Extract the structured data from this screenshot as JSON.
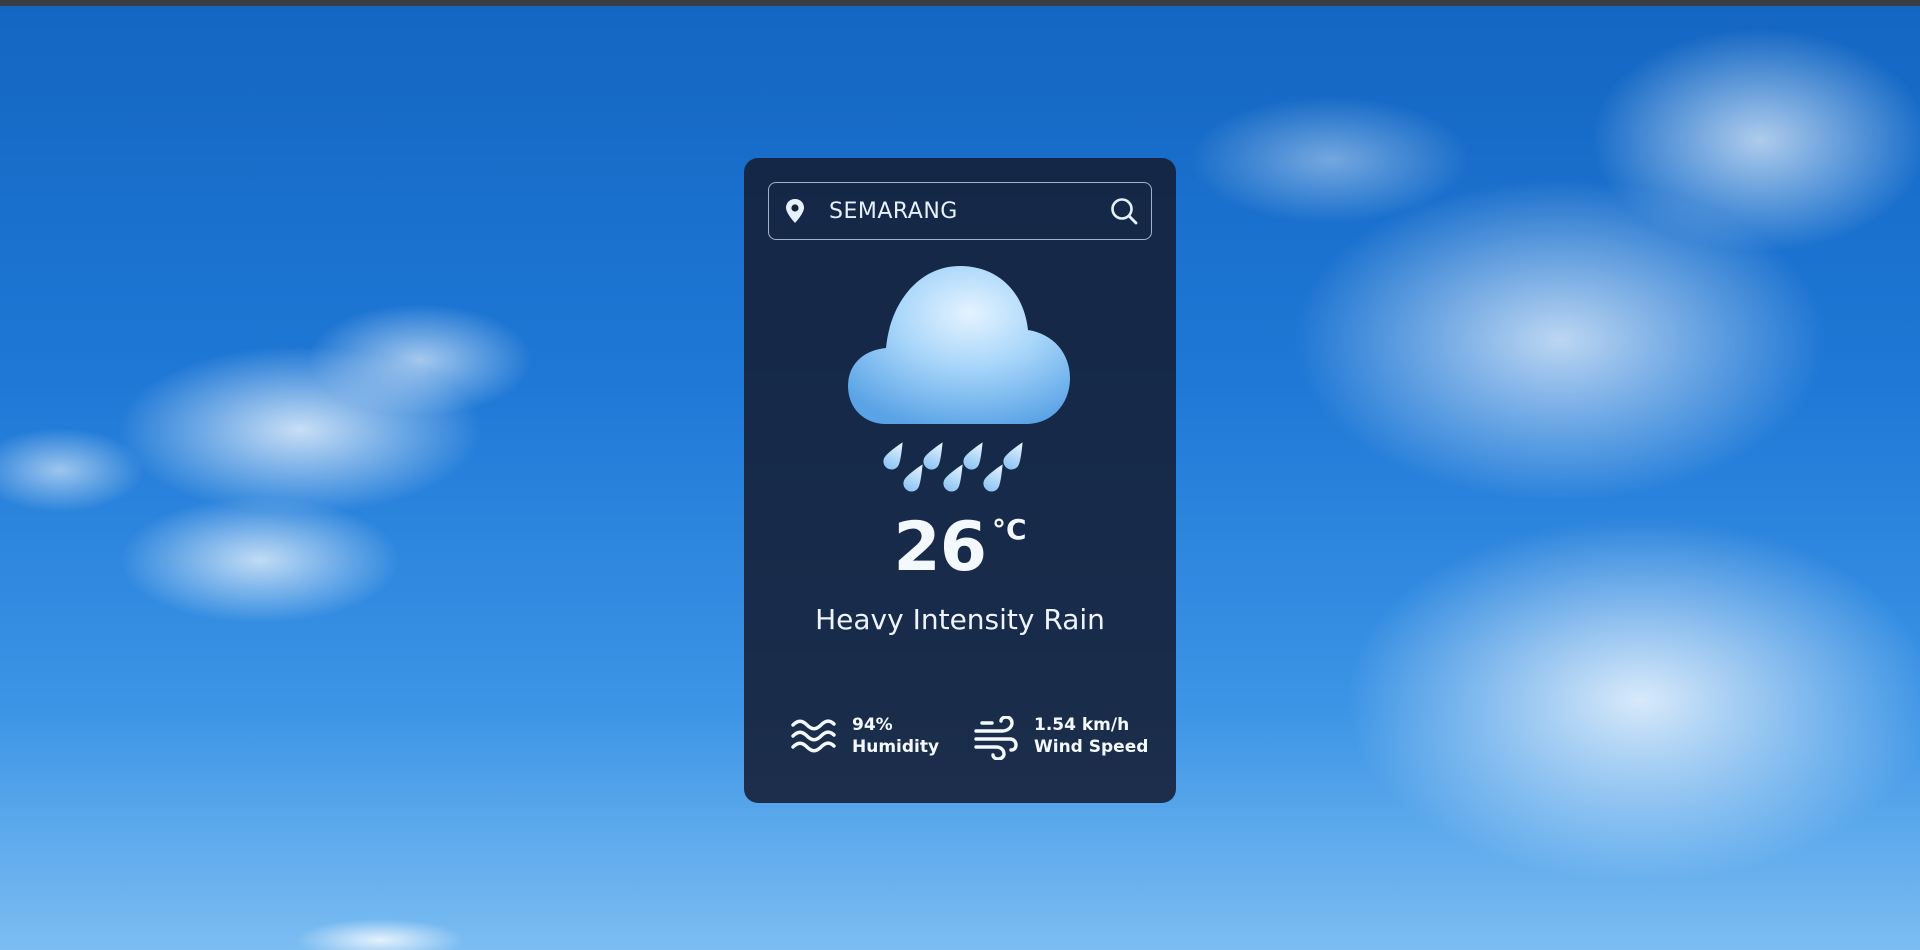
{
  "colors": {
    "card_background": "#141e34",
    "text": "#f4f8ff",
    "cloud": "#9fd0f7",
    "raindrop": "#cde6fb",
    "sky": "#1f78d6"
  },
  "search": {
    "value": "SEMARANG",
    "location_icon": "map-pin-icon",
    "search_icon": "magnifier-icon"
  },
  "weather": {
    "icon": "heavy-rain-cloud-icon",
    "temperature": "26",
    "unit": "°C",
    "description": "Heavy Intensity Rain"
  },
  "details": {
    "humidity": {
      "icon": "waves-icon",
      "value": "94%",
      "label": "Humidity"
    },
    "wind": {
      "icon": "wind-icon",
      "value": "1.54 km/h",
      "label": "Wind Speed"
    }
  }
}
